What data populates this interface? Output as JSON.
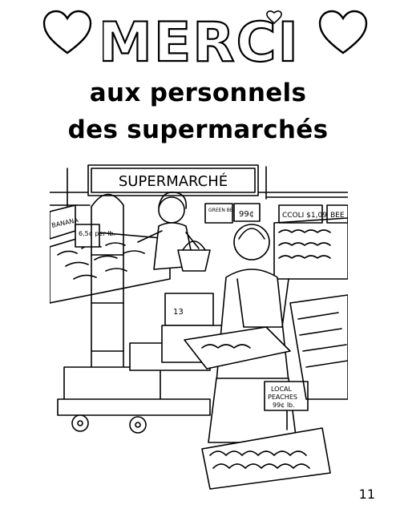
{
  "header": {
    "title": "MERCI",
    "line1": "aux personnels",
    "line2": "des supermarchés"
  },
  "illustration": {
    "store_sign": "SUPERMARCHÉ",
    "price_tag": "6,5¢ per lb.",
    "banana_sign": "BANANA",
    "green_beans_sign": "GREEN BEANS",
    "price_99": "99¢",
    "broccoli_sign": "CCOLI $1,09",
    "beet_sign": "BEE",
    "box_label": "13",
    "peaches_sign_line1": "LOCAL",
    "peaches_sign_line2": "PEACHES",
    "peaches_sign_line3": "99¢ lb."
  },
  "footer": {
    "page_number": "11"
  },
  "icons": [
    "heart-icon",
    "heart-icon"
  ]
}
